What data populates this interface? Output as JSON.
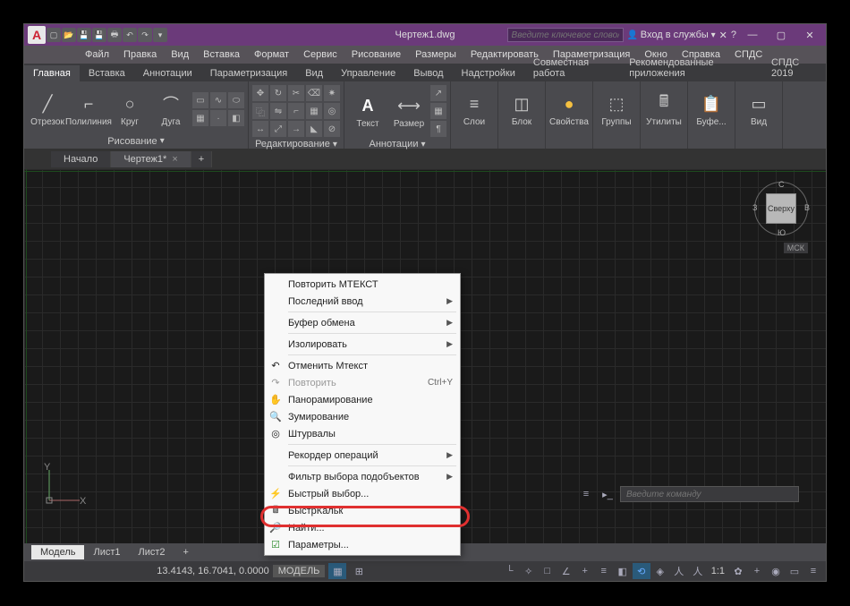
{
  "titlebar": {
    "filename": "Чертеж1.dwg",
    "search_placeholder": "Введите ключевое слово/фразу",
    "login": "Вход в службы"
  },
  "menus": [
    "Файл",
    "Правка",
    "Вид",
    "Вставка",
    "Формат",
    "Сервис",
    "Рисование",
    "Размеры",
    "Редактировать",
    "Параметризация",
    "Окно",
    "Справка",
    "СПДС"
  ],
  "ribbon_tabs": [
    "Главная",
    "Вставка",
    "Аннотации",
    "Параметризация",
    "Вид",
    "Управление",
    "Вывод",
    "Надстройки",
    "Совместная работа",
    "Рекомендованные приложения",
    "СПДС 2019"
  ],
  "ribbon": {
    "draw": {
      "title": "Рисование",
      "items": [
        "Отрезок",
        "Полилиния",
        "Круг",
        "Дуга"
      ]
    },
    "modify": {
      "title": "Редактирование"
    },
    "annot": {
      "title": "Аннотации",
      "items": [
        "Текст",
        "Размер"
      ]
    },
    "layers": {
      "title": "Слои"
    },
    "block": {
      "title": "Блок"
    },
    "props": {
      "title": "Свойства"
    },
    "groups": {
      "title": "Группы"
    },
    "utils": {
      "title": "Утилиты"
    },
    "clip": {
      "title": "Буфе..."
    },
    "view": {
      "title": "Вид"
    }
  },
  "doctabs": {
    "start": "Начало",
    "drawing": "Чертеж1*"
  },
  "viewcube": {
    "top": "Сверху",
    "n": "С",
    "s": "Ю",
    "e": "В",
    "w": "З",
    "wcs": "МСК"
  },
  "context_menu": [
    {
      "label": "Повторить МТЕКСТ",
      "type": "item"
    },
    {
      "label": "Последний ввод",
      "type": "sub"
    },
    {
      "type": "sep"
    },
    {
      "label": "Буфер обмена",
      "type": "sub"
    },
    {
      "type": "sep"
    },
    {
      "label": "Изолировать",
      "type": "sub"
    },
    {
      "type": "sep"
    },
    {
      "label": "Отменить Мтекст",
      "type": "item",
      "icon": "↶"
    },
    {
      "label": "Повторить",
      "type": "item",
      "icon": "↷",
      "shortcut": "Ctrl+Y",
      "disabled": true
    },
    {
      "label": "Панорамирование",
      "type": "item",
      "icon": "✋"
    },
    {
      "label": "Зумирование",
      "type": "item",
      "icon": "🔍"
    },
    {
      "label": "Штурвалы",
      "type": "item",
      "icon": "◎"
    },
    {
      "type": "sep"
    },
    {
      "label": "Рекордер операций",
      "type": "sub"
    },
    {
      "type": "sep"
    },
    {
      "label": "Фильтр выбора подобъектов",
      "type": "sub"
    },
    {
      "label": "Быстрый выбор...",
      "type": "item",
      "icon": "⚡"
    },
    {
      "label": "БыстрКальк",
      "type": "item",
      "icon": "🖩"
    },
    {
      "label": "Найти...",
      "type": "item",
      "icon": "🔎"
    },
    {
      "label": "Параметры...",
      "type": "item",
      "icon": "☑",
      "highlighted": true
    }
  ],
  "model_tabs": [
    "Модель",
    "Лист1",
    "Лист2"
  ],
  "status": {
    "coords": "13.4143, 16.7041, 0.0000",
    "space": "МОДЕЛЬ",
    "scale": "1:1"
  },
  "cmdline_placeholder": "Введите команду",
  "ucs": {
    "x": "X",
    "y": "Y"
  }
}
